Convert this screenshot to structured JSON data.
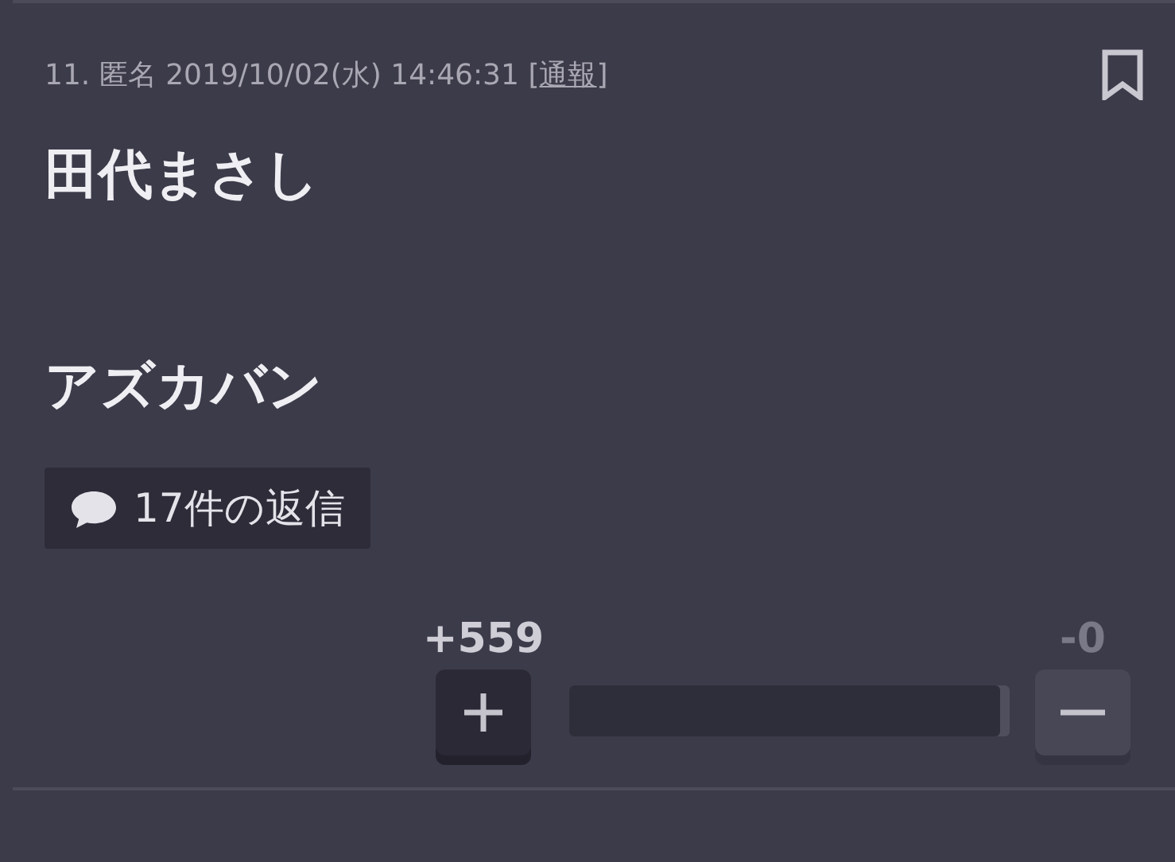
{
  "post": {
    "number": "11.",
    "author": "匿名",
    "date": "2019/10/02(水) 14:46:31",
    "report_open": "[",
    "report_link": "通報",
    "report_close": "]",
    "bookmarked": false
  },
  "body": [
    "田代まさし",
    "アズカバン"
  ],
  "replies": {
    "label": "17件の返信"
  },
  "votes": {
    "up_count": "+559",
    "down_count": "-0",
    "level": 1,
    "up_selected": true,
    "down_selected": false
  }
}
